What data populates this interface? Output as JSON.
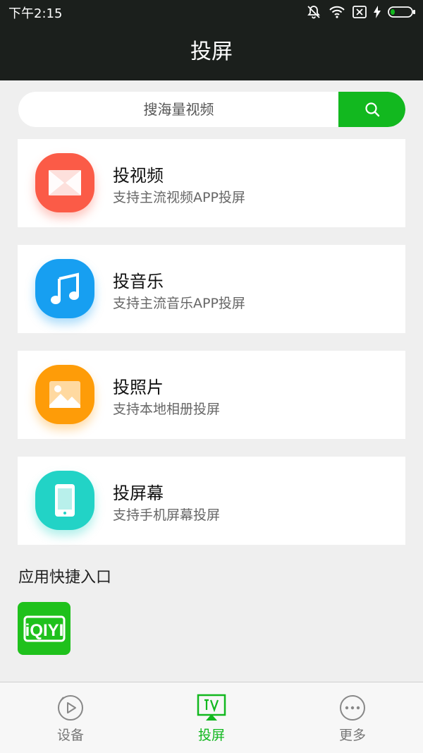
{
  "status": {
    "time": "下午2:15"
  },
  "header": {
    "title": "投屏"
  },
  "search": {
    "placeholder": "搜海量视频"
  },
  "cards": [
    {
      "title": "投视频",
      "subtitle": "支持主流视频APP投屏",
      "color": "#fb5b47",
      "icon": "video-icon"
    },
    {
      "title": "投音乐",
      "subtitle": "支持主流音乐APP投屏",
      "color": "#179ff1",
      "icon": "music-note-icon"
    },
    {
      "title": "投照片",
      "subtitle": "支持本地相册投屏",
      "color": "#fe9c08",
      "icon": "image-icon"
    },
    {
      "title": "投屏幕",
      "subtitle": "支持手机屏幕投屏",
      "color": "#22d3c6",
      "icon": "phone-icon"
    }
  ],
  "shortcuts": {
    "title": "应用快捷入口",
    "apps": [
      {
        "name": "iqiyi-app",
        "label": "iQIYI"
      }
    ]
  },
  "tabs": [
    {
      "label": "设备",
      "icon": "device-play-icon",
      "active": false
    },
    {
      "label": "投屏",
      "icon": "tv-icon",
      "active": true
    },
    {
      "label": "更多",
      "icon": "more-icon",
      "active": false
    }
  ],
  "colors": {
    "accent": "#12b81f",
    "header": "#1b1f1c"
  }
}
